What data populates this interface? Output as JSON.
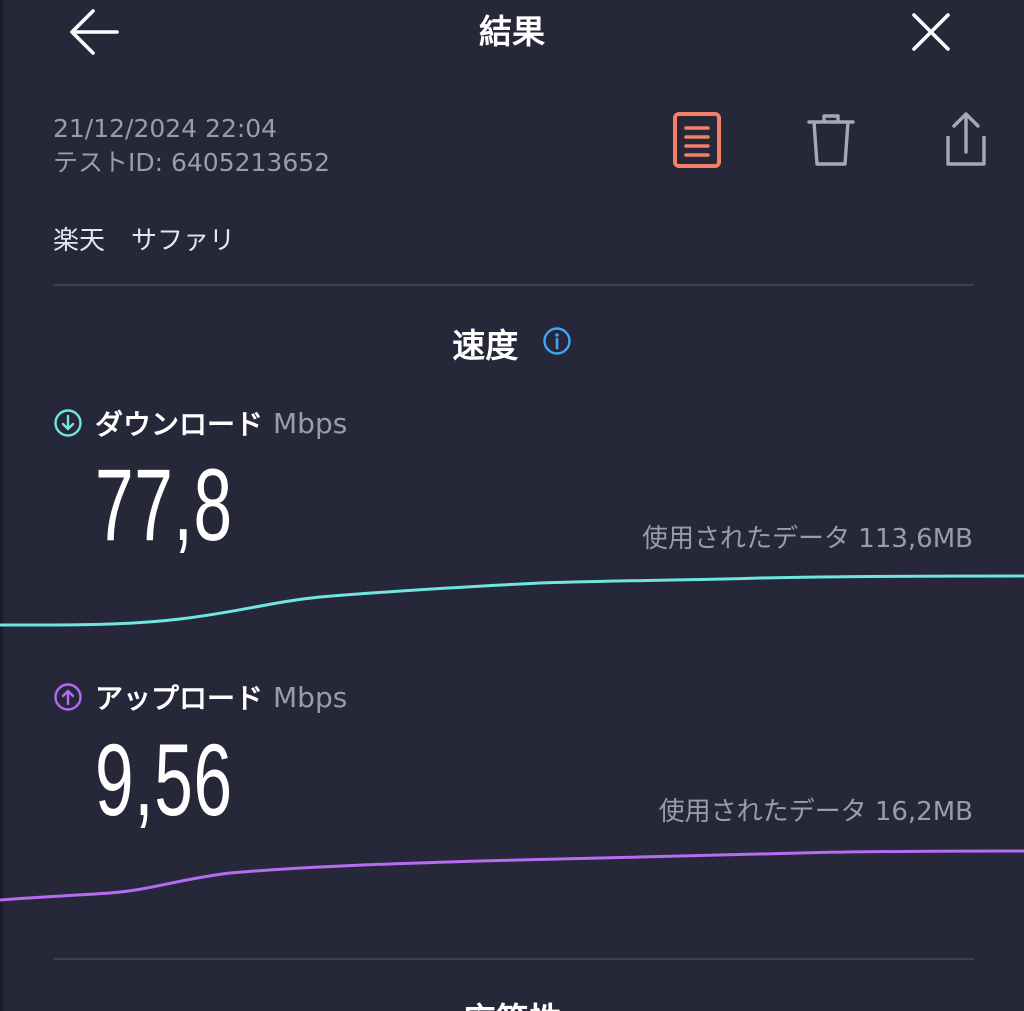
{
  "header": {
    "title": "結果",
    "back_icon": "back-arrow-icon",
    "close_icon": "close-icon"
  },
  "result": {
    "datetime": "21/12/2024 22:04",
    "test_id_label": "テストID: 6405213652",
    "provider": "楽天　サファリ"
  },
  "actions": {
    "report_icon": "report-icon",
    "delete_icon": "trash-icon",
    "share_icon": "share-icon"
  },
  "speed": {
    "title": "速度",
    "next_section_title": "応答性"
  },
  "download": {
    "label": "ダウンロード",
    "unit": "Mbps",
    "value": "77,8",
    "data_used": "使用されたデータ 113,6MB"
  },
  "upload": {
    "label": "アップロード",
    "unit": "Mbps",
    "value": "9,56",
    "data_used": "使用されたデータ 16,2MB"
  },
  "colors": {
    "background": "#262739",
    "report_accent": "#f47f66",
    "info_accent": "#3fa5f5",
    "download_accent": "#6fe6e0",
    "upload_accent": "#b56cf0",
    "secondary_text": "#9a9cad"
  }
}
